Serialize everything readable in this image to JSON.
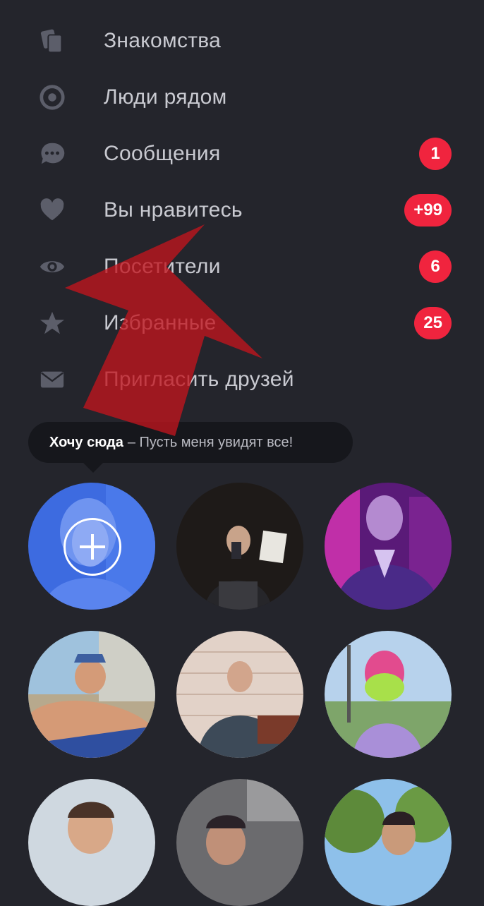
{
  "menu": {
    "items": [
      {
        "label": "Знакомства",
        "icon": "cards-icon",
        "badge": ""
      },
      {
        "label": "Люди рядом",
        "icon": "target-icon",
        "badge": ""
      },
      {
        "label": "Сообщения",
        "icon": "chat-bubble-icon",
        "badge": "1"
      },
      {
        "label": "Вы нравитесь",
        "icon": "heart-icon",
        "badge": "+99"
      },
      {
        "label": "Посетители",
        "icon": "eye-icon",
        "badge": "6"
      },
      {
        "label": "Избранные",
        "icon": "star-icon",
        "badge": "25"
      },
      {
        "label": "Пригласить друзей",
        "icon": "envelope-icon",
        "badge": ""
      }
    ]
  },
  "tooltip": {
    "bold": "Хочу сюда",
    "rest": "– Пусть меня увидят все!"
  },
  "colors": {
    "background": "#24252c",
    "badge": "#f0243e",
    "icon": "#5c5e6a",
    "label": "#c9cad1",
    "arrow": "#c0141e"
  }
}
